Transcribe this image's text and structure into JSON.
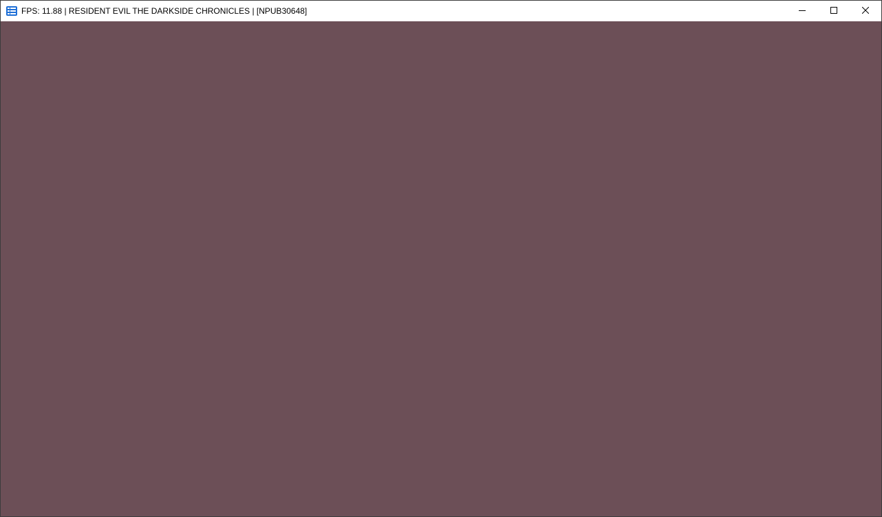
{
  "window": {
    "title": "FPS: 11.88 | RESIDENT EVIL THE DARKSIDE CHRONICLES | [NPUB30648]",
    "icon": "rpcs3-app-icon",
    "caption_buttons": [
      "minimize-icon",
      "maximize-icon",
      "close-icon"
    ]
  },
  "viewport": {
    "background_color": "#6c4f57"
  },
  "colors": {
    "titlebar": "#ffffff",
    "icon_blue": "#1e6fd6"
  }
}
